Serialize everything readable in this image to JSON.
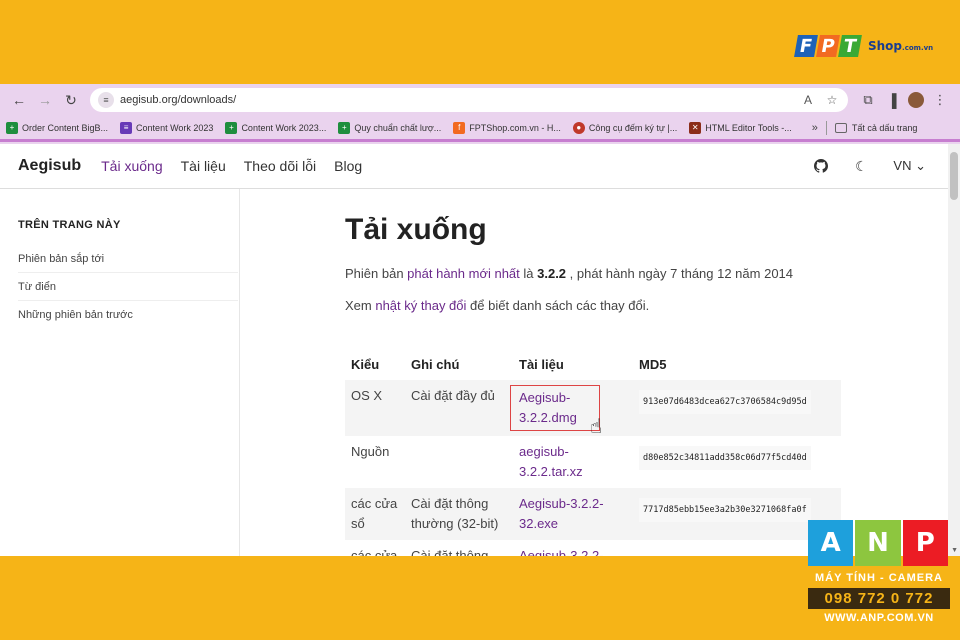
{
  "colors": {
    "background": "#f6b417",
    "accent": "#6b2a8b",
    "chrome": "#ead3ee",
    "fpt_f": "#1d62b8",
    "fpt_p": "#f26a21",
    "fpt_t": "#3aa935",
    "anp_a": "#1ea0dc",
    "anp_n": "#8dc63f",
    "anp_p": "#ec1c24"
  },
  "watermark_top": {
    "letters": [
      "F",
      "P",
      "T"
    ],
    "shop": "Shop",
    "suffix": ".com.vn"
  },
  "browser": {
    "url": "aegisub.org/downloads/",
    "icons": [
      "back-icon",
      "forward-icon",
      "reload-icon",
      "translate-icon",
      "star-icon",
      "extensions-icon",
      "sidepanel-icon",
      "menu-icon"
    ],
    "bookmarks": [
      {
        "label": "Order Content BigB...",
        "icon": "sheets-icon"
      },
      {
        "label": "Content Work 2023",
        "icon": "forms-icon"
      },
      {
        "label": "Content Work 2023...",
        "icon": "sheets-icon"
      },
      {
        "label": "Quy chuẩn chất lượ...",
        "icon": "sheets-icon"
      },
      {
        "label": "FPTShop.com.vn - H...",
        "icon": "fpt-icon"
      },
      {
        "label": "Công cụ đếm ký tự |...",
        "icon": "counter-icon"
      },
      {
        "label": "HTML Editor Tools -...",
        "icon": "html-icon"
      }
    ],
    "more": "»",
    "all_bookmarks": "Tất cả dấu trang"
  },
  "site": {
    "brand": "Aegisub",
    "nav": [
      "Tải xuống",
      "Tài liệu",
      "Theo dõi lỗi",
      "Blog"
    ],
    "lang": "VN"
  },
  "sidebar": {
    "heading": "TRÊN TRANG NÀY",
    "items": [
      "Phiên bản sắp tới",
      "Từ điển",
      "Những phiên bản trước"
    ]
  },
  "main": {
    "title": "Tải xuống",
    "p1_pre": "Phiên bản ",
    "p1_link": "phát hành mới nhất",
    "p1_mid": " là ",
    "p1_version": "3.2.2",
    "p1_post": " , phát hành ngày 7 tháng 12 năm 2014",
    "p2_pre": "Xem ",
    "p2_link": "nhật ký thay đổi",
    "p2_post": " để biết danh sách các thay đổi."
  },
  "table": {
    "headers": [
      "Kiểu",
      "Ghi chú",
      "Tài liệu",
      "MD5"
    ],
    "rows": [
      {
        "type": "OS X",
        "note": "Cài đặt đầy đủ",
        "file": "Aegisub-3.2.2.dmg",
        "md5": "913e07d6483dcea627c3706584c9d95d"
      },
      {
        "type": "Nguồn",
        "note": "",
        "file": "aegisub-3.2.2.tar.xz",
        "md5": "d80e852c34811add358c06d77f5cd40d"
      },
      {
        "type": "các cửa sổ",
        "note": "Cài đặt thông thường (32-bit)",
        "file": "Aegisub-3.2.2-32.exe",
        "md5": "7717d85ebb15ee3a2b30e3271068fa0f"
      },
      {
        "type": "các cửa",
        "note": "Cài đặt thông",
        "file": "Aegisub-3.2.2-",
        "md5": ""
      }
    ]
  },
  "watermark_bottom": {
    "letters": [
      "A",
      "N",
      "P"
    ],
    "tagline": "MÁY TÍNH - CAMERA",
    "phone": "098 772 0 772",
    "website": "WWW.ANP.COM.VN"
  }
}
